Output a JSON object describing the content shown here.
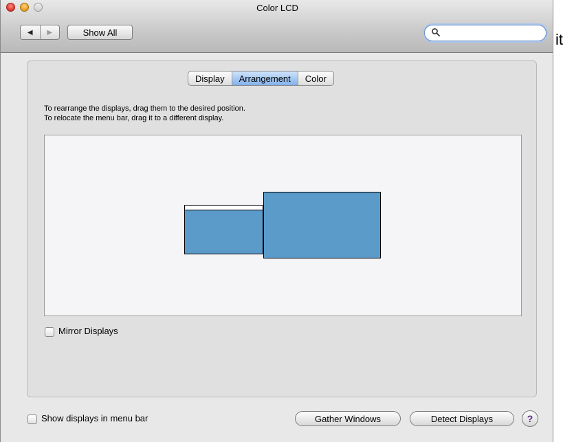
{
  "window": {
    "title": "Color LCD"
  },
  "toolbar": {
    "back_icon": "back-arrow-icon",
    "forward_icon": "forward-arrow-icon",
    "show_all_label": "Show All",
    "search": {
      "value": "",
      "placeholder": "",
      "icon": "search-icon"
    }
  },
  "outside_text": "it",
  "tabs": [
    {
      "label": "Display",
      "selected": false
    },
    {
      "label": "Arrangement",
      "selected": true
    },
    {
      "label": "Color",
      "selected": false
    }
  ],
  "arrangement": {
    "instruction_line1": "To rearrange the displays, drag them to the desired position.",
    "instruction_line2": "To relocate the menu bar, drag it to a different display.",
    "display_color": "#5b9bc9",
    "displays": [
      {
        "role": "secondary-display"
      },
      {
        "role": "primary-display-with-menu-bar"
      }
    ],
    "mirror_label": "Mirror Displays",
    "mirror_checked": false
  },
  "footer": {
    "show_in_menubar_label": "Show displays in menu bar",
    "show_in_menubar_checked": false,
    "gather_label": "Gather Windows",
    "detect_label": "Detect Displays",
    "help_label": "?"
  }
}
